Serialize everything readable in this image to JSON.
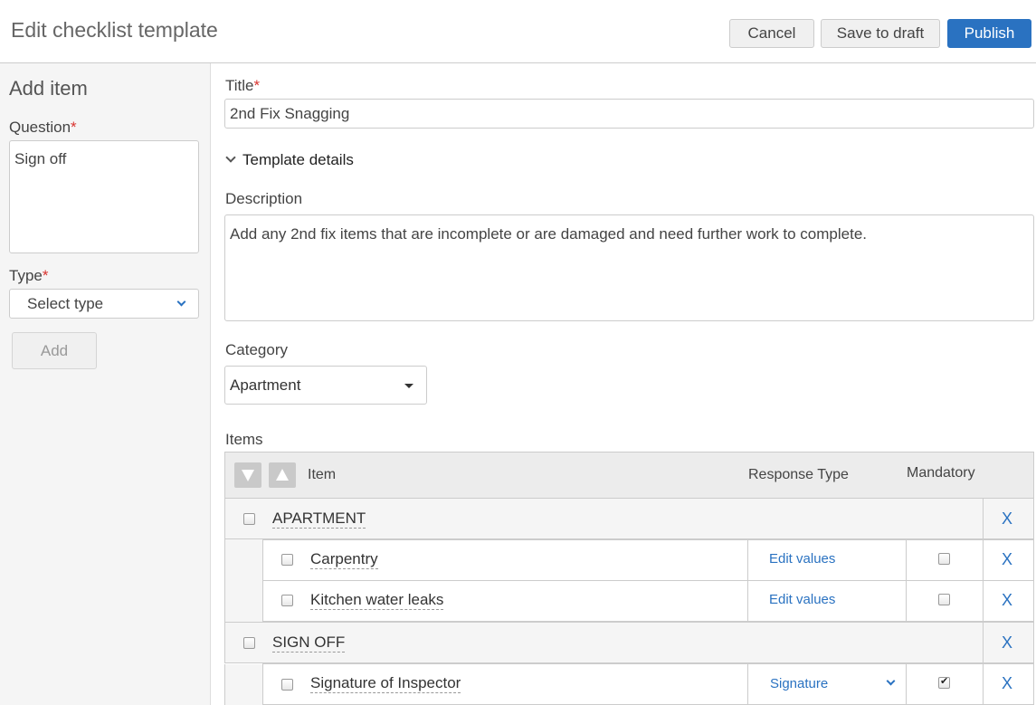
{
  "header": {
    "title": "Edit checklist template",
    "cancel_label": "Cancel",
    "save_draft_label": "Save to draft",
    "publish_label": "Publish"
  },
  "sidebar": {
    "title": "Add item",
    "question_label": "Question",
    "question_value": "Sign off",
    "type_label": "Type",
    "type_placeholder": "Select type",
    "add_label": "Add",
    "required_mark": "*"
  },
  "form": {
    "title_label": "Title",
    "title_value": "2nd Fix Snagging",
    "details_toggle": "Template details",
    "description_label": "Description",
    "description_value": "Add any 2nd fix items that are incomplete or are damaged and need further work to complete.",
    "category_label": "Category",
    "category_value": "Apartment",
    "items_label": "Items"
  },
  "table": {
    "col_item": "Item",
    "col_response": "Response Type",
    "col_mandatory": "Mandatory",
    "remove_label": "X",
    "groups": [
      {
        "name": "APARTMENT",
        "items": [
          {
            "name": "Carpentry",
            "response": "Edit values",
            "mandatory": false
          },
          {
            "name": "Kitchen water leaks",
            "response": "Edit values",
            "mandatory": false
          }
        ]
      },
      {
        "name": "SIGN OFF",
        "items": [
          {
            "name": "Signature of Inspector",
            "response": "Signature",
            "mandatory": true
          }
        ]
      }
    ]
  },
  "colors": {
    "accent": "#2a72c1",
    "required": "#d9332f"
  }
}
